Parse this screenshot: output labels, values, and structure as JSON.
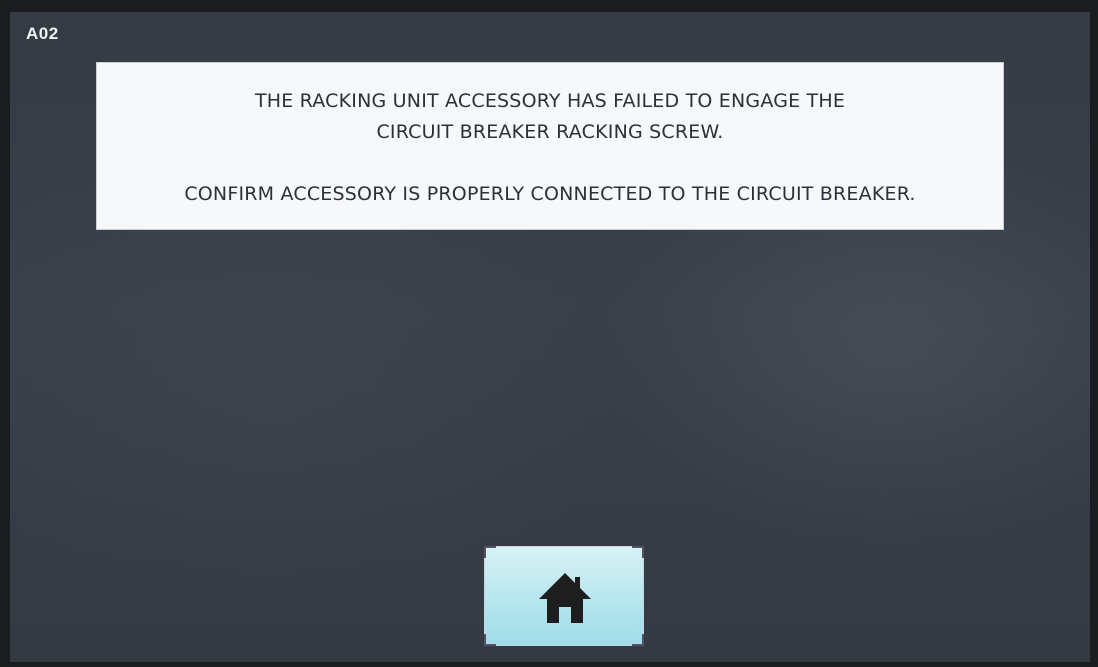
{
  "screen": {
    "code": "A02"
  },
  "message": {
    "line1": "THE RACKING UNIT ACCESSORY HAS FAILED TO ENGAGE THE",
    "line2": "CIRCUIT BREAKER RACKING SCREW.",
    "line3": "CONFIRM ACCESSORY IS PROPERLY CONNECTED TO THE CIRCUIT BREAKER."
  },
  "home_button": {
    "icon": "home-icon"
  },
  "colors": {
    "screen_background": "#363c44",
    "message_background": "#f7f8fa",
    "message_text": "#2c3138",
    "button_background": "#b6e6ee",
    "icon_fill": "#1e1e1e"
  }
}
